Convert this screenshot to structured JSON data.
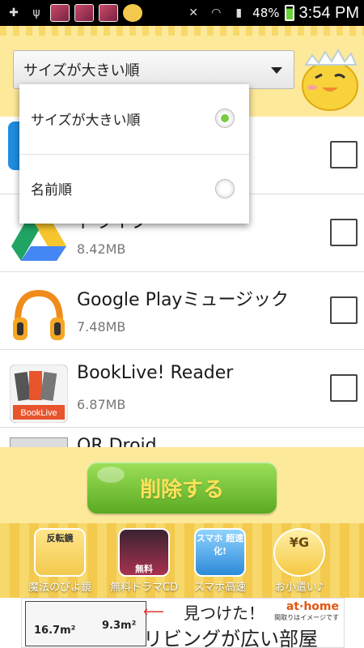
{
  "status_bar": {
    "battery": "48%",
    "time": "3:54 PM"
  },
  "sort": {
    "selected": "サイズが大きい順",
    "options": [
      {
        "label": "サイズが大きい順",
        "selected": true
      },
      {
        "label": "名前順",
        "selected": false
      }
    ]
  },
  "apps": [
    {
      "name": "",
      "size": "",
      "checked": false,
      "icon": "blue-app-icon"
    },
    {
      "name": "ドライブ",
      "size": "8.42MB",
      "checked": false,
      "icon": "google-drive-icon"
    },
    {
      "name": "Google Playミュージック",
      "size": "7.48MB",
      "checked": false,
      "icon": "headphones-icon"
    },
    {
      "name": "BookLive! Reader",
      "size": "6.87MB",
      "checked": false,
      "icon": "booklive-icon"
    },
    {
      "name": "QR Droid",
      "size": "",
      "checked": false,
      "icon": "qr-icon"
    }
  ],
  "action": {
    "delete_label": "削除する"
  },
  "promos": [
    {
      "label": "魔法のぴよ鏡",
      "icon_text": "反転鏡"
    },
    {
      "label": "無料ドラマCD",
      "icon_text": "無料"
    },
    {
      "label": "スマホ高速",
      "icon_text": "スマホ 超速化!"
    },
    {
      "label": "お小遣い♪",
      "icon_text": "¥G"
    }
  ],
  "ad": {
    "room1": "16.7m²",
    "room2": "9.3m²",
    "headline1": "見つけた！",
    "headline2": "リビングが広い部屋",
    "brand": "at·home",
    "note": "間取りはイメージです"
  },
  "colors": {
    "header_bg": "#fde99a",
    "button_green": "#5aaa22",
    "button_text": "#ffe35a",
    "radio_on": "#7ac943"
  }
}
